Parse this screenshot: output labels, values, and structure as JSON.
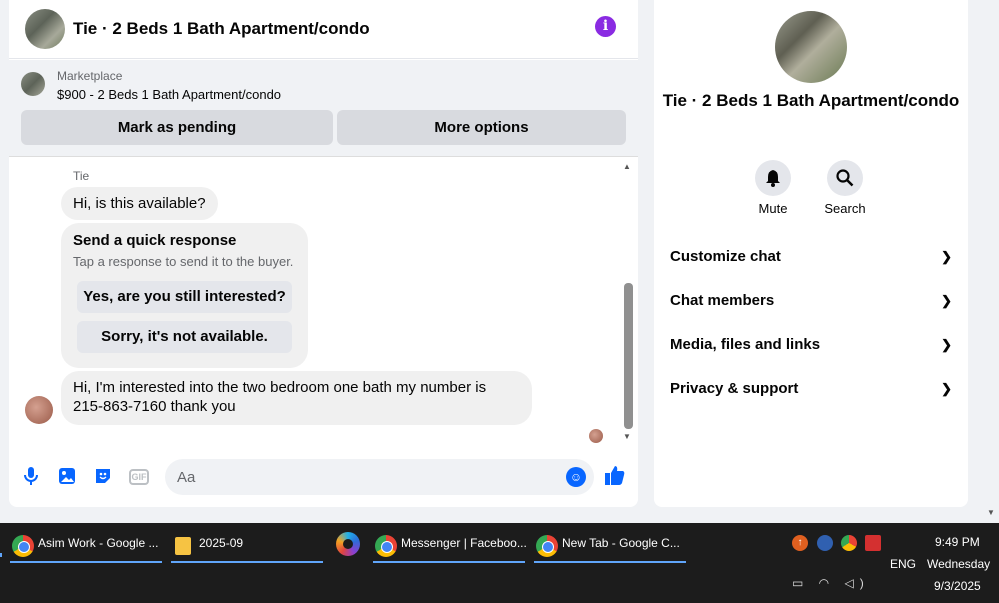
{
  "chat": {
    "title": "Tie · 2 Beds 1 Bath Apartment/condo",
    "marketplace_label": "Marketplace",
    "listing": "$900 - 2 Beds 1 Bath Apartment/condo",
    "mark_pending": "Mark as pending",
    "more_options": "More options",
    "sender": "Tie",
    "message1": "Hi, is this available?",
    "quick_title": "Send a quick response",
    "quick_sub": "Tap a response to send it to the buyer.",
    "quick_options": [
      "Yes, are you still interested?",
      "Sorry, it's not available."
    ],
    "message2": "Hi, I'm interested into the two bedroom one bath my number is 215-863-7160 thank you",
    "composer_placeholder": "Aa"
  },
  "side": {
    "title": "Tie · 2 Beds 1 Bath Apartment/condo",
    "mute": "Mute",
    "search": "Search",
    "sections": [
      "Customize chat",
      "Chat members",
      "Media, files and links",
      "Privacy & support"
    ]
  },
  "taskbar": {
    "items": [
      "Asim Work - Google ...",
      "2025-09",
      "Messenger | Faceboo...",
      "New Tab - Google C..."
    ],
    "lang": "ENG",
    "time": "9:49 PM",
    "day": "Wednesday",
    "date": "9/3/2025"
  },
  "colors": {
    "accent": "#0866ff",
    "info": "#8a2be2",
    "taskbar": "#1c1c1c"
  }
}
